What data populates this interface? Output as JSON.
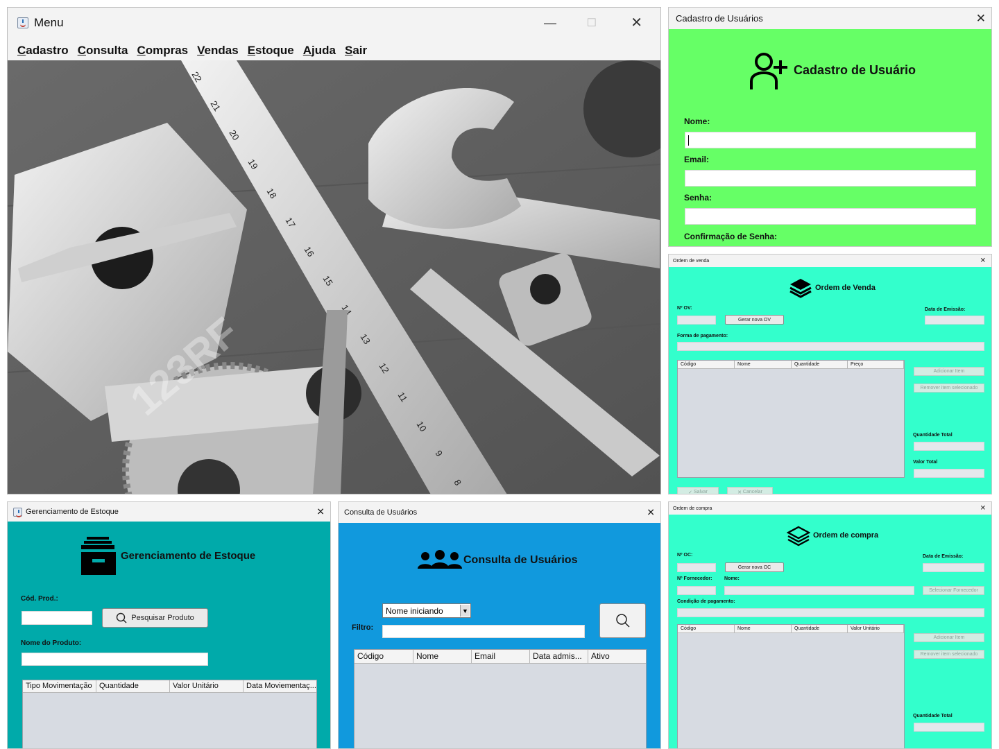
{
  "menu_window": {
    "title": "Menu",
    "menus": [
      "Cadastro",
      "Consulta",
      "Compras",
      "Vendas",
      "Estoque",
      "Ajuda",
      "Sair"
    ],
    "image": {
      "watermark": "123RF",
      "ruler_numbers": [
        "22",
        "21",
        "20",
        "19",
        "18",
        "17",
        "16",
        "15",
        "14",
        "13",
        "12",
        "11",
        "10",
        "9",
        "8"
      ]
    }
  },
  "cadastro_usuarios": {
    "title": "Cadastro de Usuários",
    "heading": "Cadastro de Usuário",
    "nome_label": "Nome:",
    "email_label": "Email:",
    "senha_label": "Senha:",
    "confirmacao_label": "Confirmação de Senha:",
    "bg_color": "#66ff66"
  },
  "ordem_venda": {
    "title": "Ordem de venda",
    "heading": "Ordem de Venda",
    "nov_label": "Nº OV:",
    "gerar_button": "Gerar nova OV",
    "data_emissao_label": "Data de Emissão:",
    "forma_pagamento_label": "Forma de pagamento:",
    "columns": [
      "Código",
      "Nome",
      "Quantidade",
      "Preço"
    ],
    "adicionar_button": "Adicionar Item",
    "remover_button": "Remover item selecionado",
    "quantidade_total_label": "Quantidade Total",
    "valor_total_label": "Valor Total",
    "salvar_button": "Salvar",
    "cancelar_button": "Cancelar",
    "bg_color": "#33ffcc"
  },
  "gerenciamento_estoque": {
    "title": "Gerenciamento de Estoque",
    "heading": "Gerenciamento de Estoque",
    "cod_label": "Cód. Prod.:",
    "pesquisar_button": "Pesquisar Produto",
    "nome_label": "Nome do Produto:",
    "columns": [
      "Tipo Movimentação",
      "Quantidade",
      "Valor Unitário",
      "Data Moviementaç..."
    ],
    "bg_color": "#00aaaa"
  },
  "consulta_usuarios": {
    "title": "Consulta de Usuários",
    "heading": "Consulta de Usuários",
    "dropdown_value": "Nome iniciando",
    "filtro_label": "Filtro:",
    "columns": [
      "Código",
      "Nome",
      "Email",
      "Data admis...",
      "Ativo"
    ],
    "bg_color": "#1199dd"
  },
  "ordem_compra": {
    "title": "Ordem de compra",
    "heading": "Ordem de compra",
    "noc_label": "Nº OC:",
    "gerar_button": "Gerar nova OC",
    "data_emissao_label": "Data de Emissão:",
    "fornecedor_label": "Nº Fornecedor:",
    "nome_label": "Nome:",
    "selecionar_button": "Selecionar Fornecedor",
    "condicao_label": "Condição de pagamento:",
    "columns": [
      "Código",
      "Nome",
      "Quantidade",
      "Valor Unitário"
    ],
    "adicionar_button": "Adicionar Item",
    "remover_button": "Remover item selecionado",
    "quantidade_total_label": "Quantidade Total",
    "bg_color": "#33ffcc"
  }
}
